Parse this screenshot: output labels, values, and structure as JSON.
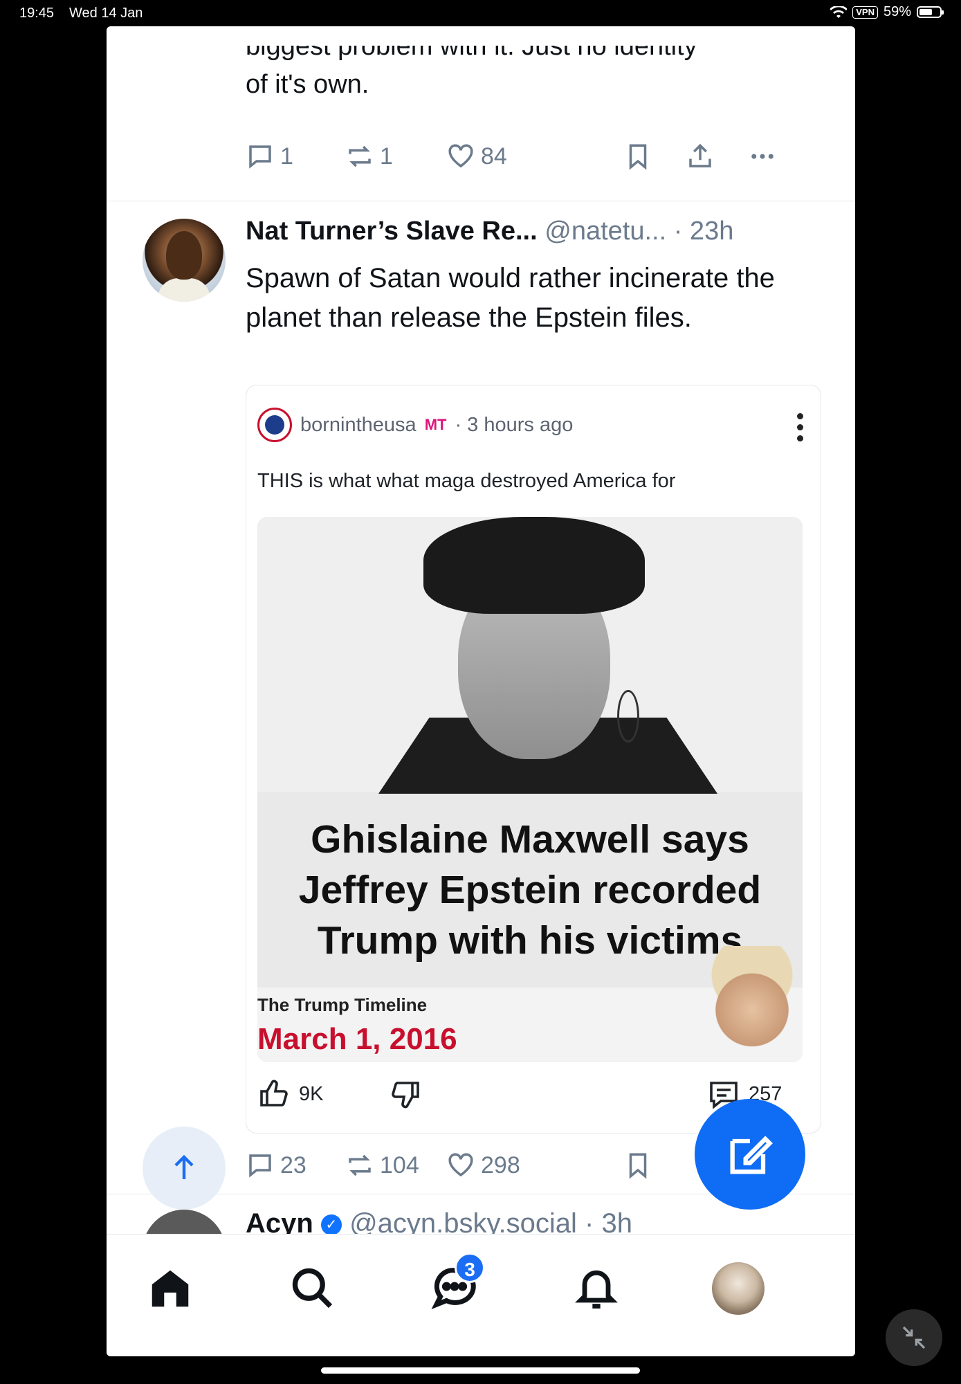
{
  "status_bar": {
    "time": "19:45",
    "date": "Wed 14 Jan",
    "vpn": "VPN",
    "battery": "59%"
  },
  "previous_post": {
    "text_clipped": "biggest problem with it. Just no identity",
    "text_last": "of it's own.",
    "actions": {
      "replies": "1",
      "reposts": "1",
      "likes": "84"
    }
  },
  "post": {
    "author_name": "Nat Turner’s Slave Re...",
    "handle": "@natetu...",
    "time": "· 23h",
    "text": "Spawn of Satan would rather incinerate the planet than release the Epstein files.",
    "embed": {
      "source_user": "bornintheusa",
      "source_tag": "MT",
      "source_time": "· 3 hours ago",
      "caption": "THIS is what what maga destroyed America for",
      "headline": "Ghislaine Maxwell says Jeffrey Epstein recorded Trump with his victims",
      "timeline_title": "The Trump Timeline",
      "timeline_date": "March 1, 2016",
      "likes": "9K",
      "comments": "257"
    },
    "actions": {
      "replies": "23",
      "reposts": "104",
      "likes": "298"
    }
  },
  "next_post": {
    "author_name": "Acyn",
    "handle": "@acyn.bsky.social · 3h"
  },
  "bottom_nav": {
    "messages_badge": "3"
  },
  "colors": {
    "accent": "#0f6cf5",
    "muted": "#6b7a8c",
    "timeline_red": "#c8102e"
  }
}
